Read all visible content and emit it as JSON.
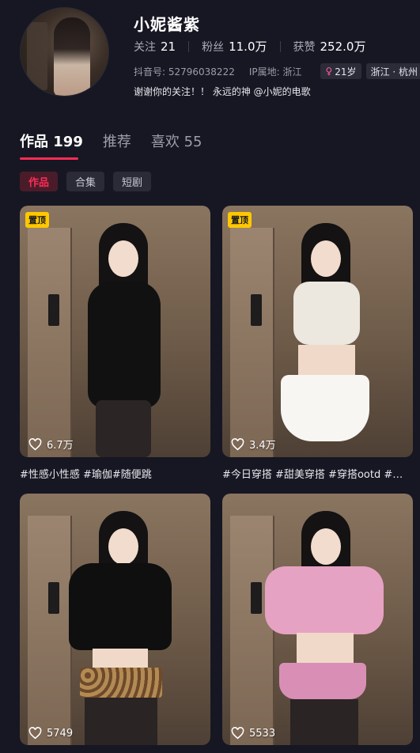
{
  "profile": {
    "nickname": "小妮酱紫",
    "follow_label": "关注",
    "follow_count": "21",
    "fans_label": "粉丝",
    "fans_count": "11.0万",
    "likes_label": "获赞",
    "likes_count": "252.0万",
    "douyin_id": "抖音号: 52796038222",
    "ip_location": "IP属地: 浙江",
    "age_tag": "21岁",
    "region_tag": "浙江 · 杭州",
    "bio": "谢谢你的关注！！ 永远的神 @小妮的电歌"
  },
  "tabs": [
    {
      "label": "作品 199",
      "active": true
    },
    {
      "label": "推荐",
      "active": false
    },
    {
      "label": "喜欢 55",
      "active": false
    }
  ],
  "filters": [
    {
      "label": "作品",
      "active": true
    },
    {
      "label": "合集",
      "active": false
    },
    {
      "label": "短剧",
      "active": false
    }
  ],
  "posts": [
    {
      "pinned_label": "置顶",
      "likes": "6.7万",
      "caption": "#性感小性感 #瑜伽#随便跳",
      "outfit": "black"
    },
    {
      "pinned_label": "置顶",
      "likes": "3.4万",
      "caption": "#今日穿搭 #甜美穿搭 #穿搭ootd #…",
      "outfit": "white"
    },
    {
      "pinned_label": "",
      "likes": "5749",
      "caption": "",
      "outfit": "leopard"
    },
    {
      "pinned_label": "",
      "likes": "5533",
      "caption": "",
      "outfit": "pink"
    }
  ],
  "colors": {
    "background": "#161722",
    "accent": "#fe2c55",
    "pinned_badge": "#ffc800"
  },
  "icons": {
    "heart": "heart-icon",
    "female": "female-icon"
  }
}
